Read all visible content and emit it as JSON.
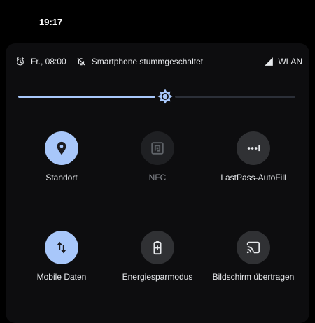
{
  "statusbar": {
    "time": "19:17"
  },
  "info": {
    "alarm_icon": "alarm-clock-icon",
    "alarm_text": "Fr., 08:00",
    "mute_icon": "bell-off-icon",
    "mute_text": "Smartphone stummgeschaltet",
    "signal_icon": "signal-icon",
    "network_text": "WLAN"
  },
  "brightness": {
    "level": 0.53,
    "accent": "#a8c7fa"
  },
  "tiles": [
    {
      "label": "Standort",
      "icon": "location-pin-icon",
      "state": "active"
    },
    {
      "label": "NFC",
      "icon": "nfc-icon",
      "state": "disabled"
    },
    {
      "label": "LastPass-AutoFill",
      "icon": "password-dots-icon",
      "state": "inactive"
    },
    {
      "label": "Mobile Daten",
      "icon": "mobile-data-icon",
      "state": "active"
    },
    {
      "label": "Energiesparmodus",
      "icon": "battery-saver-icon",
      "state": "inactive"
    },
    {
      "label": "Bildschirm übertragen",
      "icon": "cast-icon",
      "state": "inactive"
    }
  ]
}
